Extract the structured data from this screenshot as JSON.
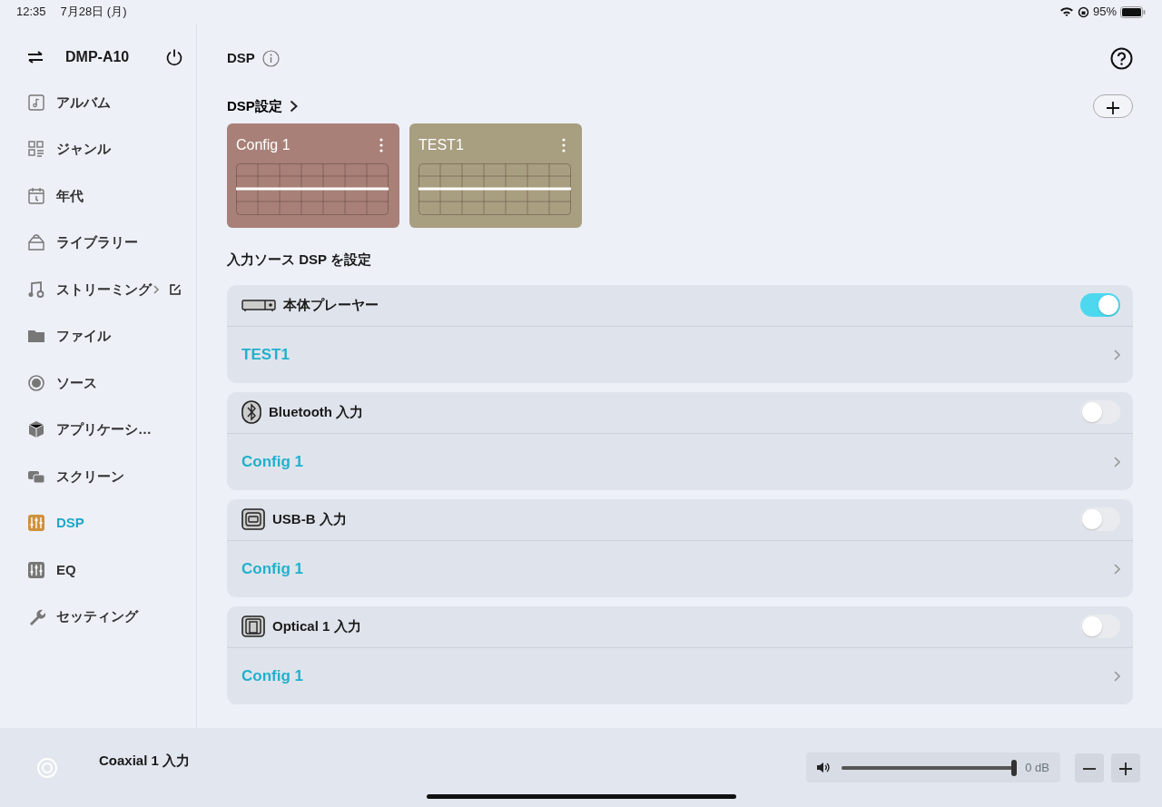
{
  "status_bar": {
    "time": "12:35",
    "date": "7月28日 (月)",
    "battery": "95%"
  },
  "sidebar": {
    "device": "DMP-A10",
    "items": [
      {
        "label": "アルバム",
        "kind": "album",
        "selected": false
      },
      {
        "label": "ジャンル",
        "kind": "genre",
        "selected": false
      },
      {
        "label": "年代",
        "kind": "calendar",
        "selected": false
      },
      {
        "label": "ライブラリー",
        "kind": "library",
        "selected": false
      },
      {
        "label": "ストリーミング",
        "kind": "streaming",
        "selected": false
      },
      {
        "label": "ファイル",
        "kind": "folder",
        "selected": false
      },
      {
        "label": "ソース",
        "kind": "source",
        "selected": false
      },
      {
        "label": "アプリケーシ…",
        "kind": "cube",
        "selected": false
      },
      {
        "label": "スクリーン",
        "kind": "screen",
        "selected": false
      },
      {
        "label": "DSP",
        "kind": "dsp",
        "selected": true
      },
      {
        "label": "EQ",
        "kind": "eq",
        "selected": false
      },
      {
        "label": "セッティング",
        "kind": "wrench",
        "selected": false
      }
    ]
  },
  "header": {
    "title": "DSP"
  },
  "dsp_settings": {
    "title": "DSP設定",
    "configs": [
      {
        "name": "Config 1",
        "color": "#a88078"
      },
      {
        "name": "TEST1",
        "color": "#a89e80"
      }
    ]
  },
  "input_sources": {
    "title": "入力ソース DSP を設定",
    "items": [
      {
        "name": "本体プレーヤー",
        "kind": "player",
        "on": true,
        "config": "TEST1"
      },
      {
        "name": "Bluetooth 入力",
        "kind": "bluetooth",
        "on": false,
        "config": "Config 1"
      },
      {
        "name": "USB-B 入力",
        "kind": "usb",
        "on": false,
        "config": "Config 1"
      },
      {
        "name": "Optical 1 入力",
        "kind": "optical",
        "on": false,
        "config": "Config 1"
      }
    ]
  },
  "player": {
    "source": "Coaxial 1 入力",
    "volume": {
      "level": 1.0,
      "reading": "0 dB"
    }
  }
}
